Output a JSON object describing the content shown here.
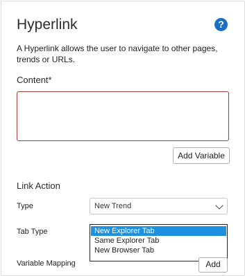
{
  "title": "Hyperlink",
  "help_icon": "question-circle-icon",
  "help_glyph": "?",
  "description": "A Hyperlink allows the user to navigate to other pages, trends or URLs.",
  "content": {
    "label": "Content*",
    "value": ""
  },
  "add_variable_label": "Add Variable",
  "link_action": {
    "heading": "Link Action",
    "type_label": "Type",
    "type_value": "New Trend",
    "tab_type_label": "Tab Type",
    "tab_type_options": [
      "New Explorer Tab",
      "Same Explorer Tab",
      "New Browser Tab"
    ],
    "tab_type_selected": "New Explorer Tab",
    "variable_mapping_label": "Variable Mapping",
    "add_label": "Add"
  },
  "colors": {
    "help": "#1b6fc3",
    "error_border": "#a83a3a",
    "selection": "#1e90e0"
  }
}
